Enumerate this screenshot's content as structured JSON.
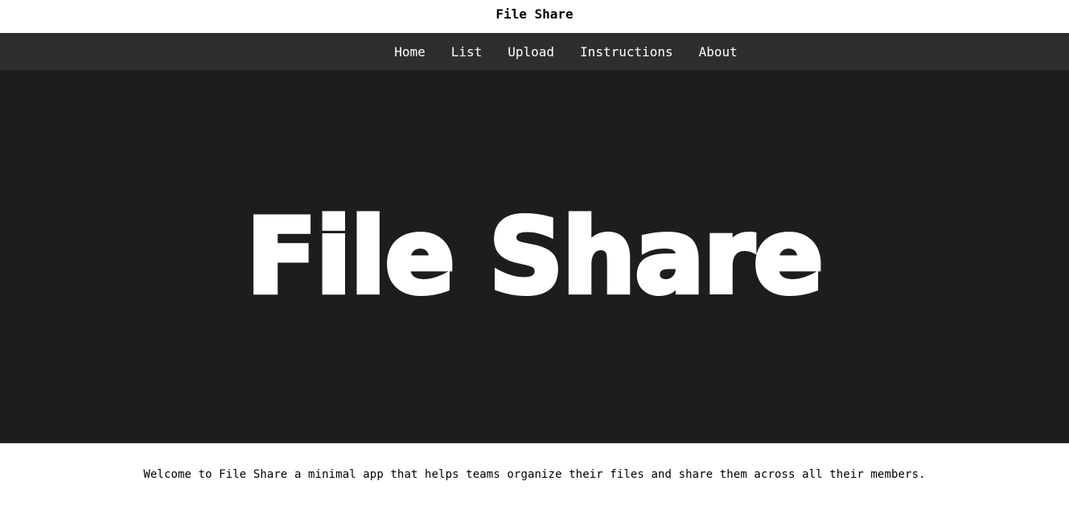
{
  "header": {
    "title": "File Share"
  },
  "nav": {
    "items": [
      {
        "label": "Home"
      },
      {
        "label": "List"
      },
      {
        "label": "Upload"
      },
      {
        "label": "Instructions"
      },
      {
        "label": "About"
      }
    ]
  },
  "hero": {
    "title": "File Share"
  },
  "main": {
    "welcome_text": "Welcome to File Share a minimal app that helps teams organize their files and share them across all their members."
  },
  "colors": {
    "nav_background": "#2e2e2e",
    "hero_background": "#1d1d1d",
    "page_background": "#ffffff"
  }
}
